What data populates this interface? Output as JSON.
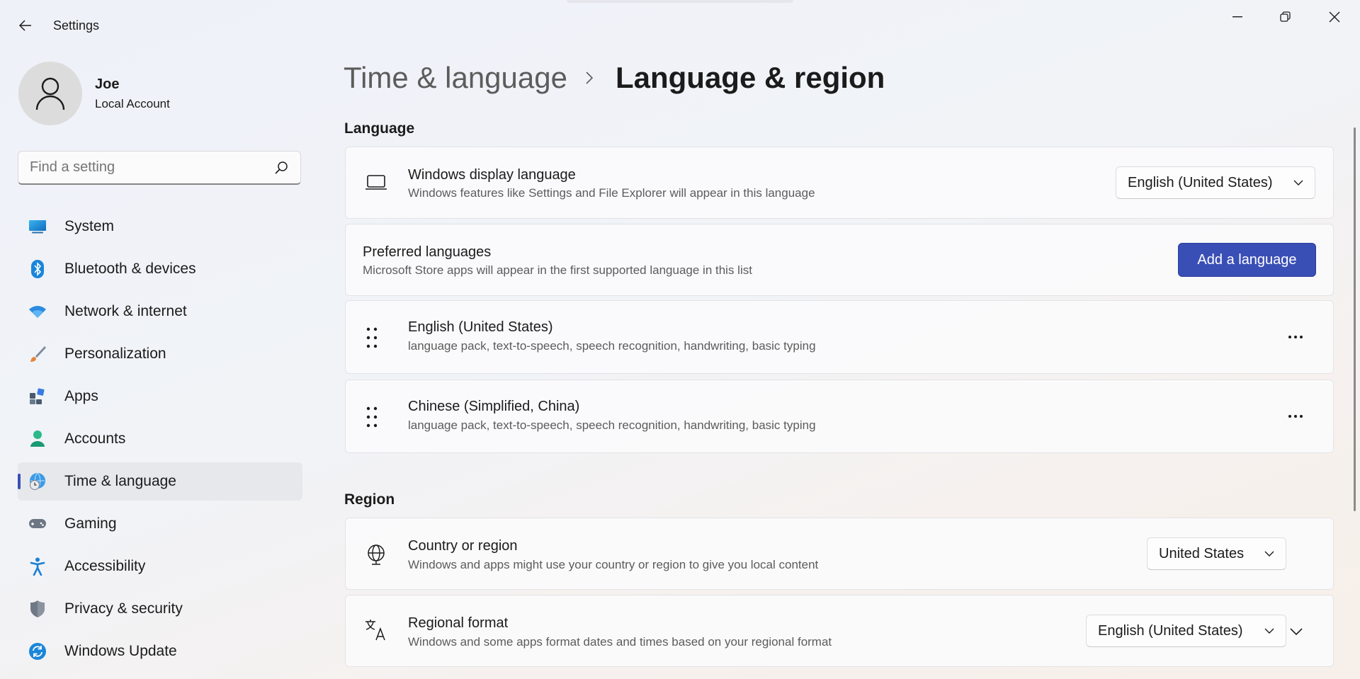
{
  "window": {
    "title": "Settings"
  },
  "profile": {
    "name": "Joe",
    "account_type": "Local Account"
  },
  "search": {
    "placeholder": "Find a setting"
  },
  "sidebar": {
    "items": [
      {
        "label": "System",
        "icon": "system-icon"
      },
      {
        "label": "Bluetooth & devices",
        "icon": "bluetooth-icon"
      },
      {
        "label": "Network & internet",
        "icon": "wifi-icon"
      },
      {
        "label": "Personalization",
        "icon": "brush-icon"
      },
      {
        "label": "Apps",
        "icon": "apps-icon"
      },
      {
        "label": "Accounts",
        "icon": "person-icon"
      },
      {
        "label": "Time & language",
        "icon": "globe-clock-icon",
        "active": true
      },
      {
        "label": "Gaming",
        "icon": "gamepad-icon"
      },
      {
        "label": "Accessibility",
        "icon": "accessibility-icon"
      },
      {
        "label": "Privacy & security",
        "icon": "shield-icon"
      },
      {
        "label": "Windows Update",
        "icon": "update-icon"
      }
    ]
  },
  "breadcrumb": {
    "parent": "Time & language",
    "current": "Language & region"
  },
  "language_section": {
    "title": "Language",
    "display_language": {
      "title": "Windows display language",
      "description": "Windows features like Settings and File Explorer will appear in this language",
      "value": "English (United States)"
    },
    "preferred": {
      "title": "Preferred languages",
      "description": "Microsoft Store apps will appear in the first supported language in this list",
      "button": "Add a language"
    },
    "languages": [
      {
        "name": "English (United States)",
        "features": "language pack, text-to-speech, speech recognition, handwriting, basic typing"
      },
      {
        "name": "Chinese (Simplified, China)",
        "features": "language pack, text-to-speech, speech recognition, handwriting, basic typing"
      }
    ]
  },
  "region_section": {
    "title": "Region",
    "country": {
      "title": "Country or region",
      "description": "Windows and apps might use your country or region to give you local content",
      "value": "United States"
    },
    "format": {
      "title": "Regional format",
      "description": "Windows and some apps format dates and times based on your regional format",
      "value": "English (United States)"
    }
  },
  "colors": {
    "accent": "#3a4fb5"
  }
}
